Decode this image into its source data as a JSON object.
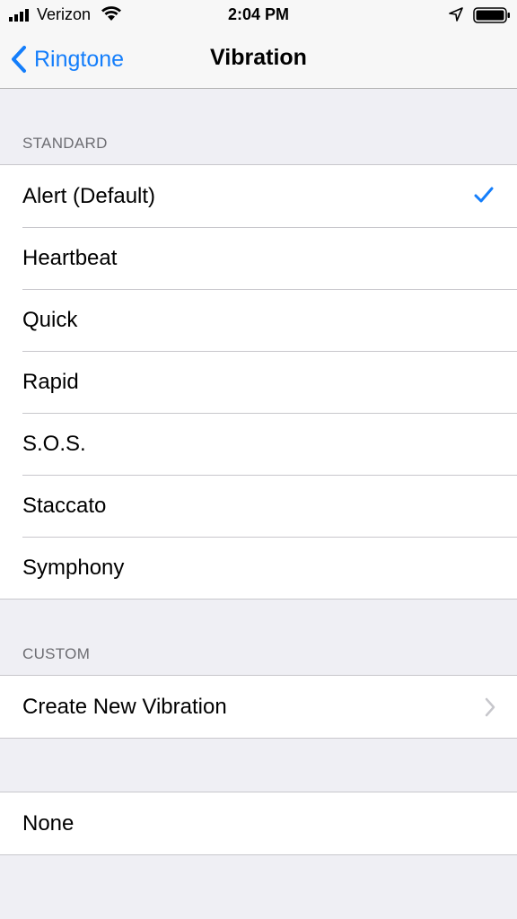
{
  "status_bar": {
    "carrier": "Verizon",
    "time": "2:04 PM"
  },
  "nav": {
    "back_label": "Ringtone",
    "title": "Vibration"
  },
  "standard": {
    "header": "STANDARD",
    "items": [
      {
        "label": "Alert (Default)",
        "selected": true
      },
      {
        "label": "Heartbeat",
        "selected": false
      },
      {
        "label": "Quick",
        "selected": false
      },
      {
        "label": "Rapid",
        "selected": false
      },
      {
        "label": "S.O.S.",
        "selected": false
      },
      {
        "label": "Staccato",
        "selected": false
      },
      {
        "label": "Symphony",
        "selected": false
      }
    ]
  },
  "custom": {
    "header": "CUSTOM",
    "create_label": "Create New Vibration"
  },
  "none_label": "None",
  "colors": {
    "accent": "#147efb",
    "background": "#efeff4",
    "separator": "#c8c7cc",
    "section_header": "#6d6d72"
  },
  "icons": [
    "signal-icon",
    "wifi-icon",
    "location-icon",
    "battery-icon",
    "back-chevron-icon",
    "checkmark-icon",
    "chevron-right-icon"
  ]
}
